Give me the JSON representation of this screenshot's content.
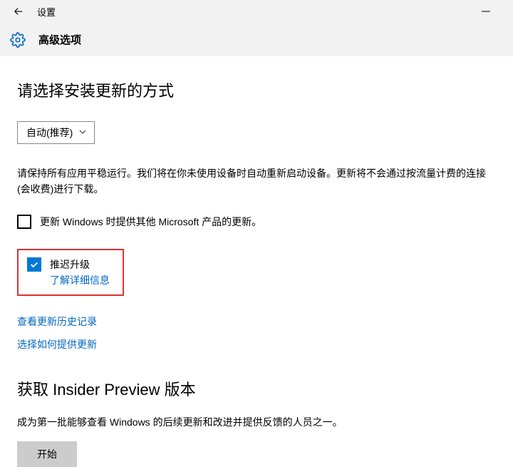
{
  "titlebar": {
    "title": "设置"
  },
  "subheader": {
    "title": "高级选项"
  },
  "section1": {
    "heading": "请选择安装更新的方式",
    "dropdown_value": "自动(推荐)",
    "paragraph": "请保持所有应用平稳运行。我们将在你未使用设备时自动重新启动设备。更新将不会通过按流量计费的连接(会收费)进行下载。",
    "checkbox_other_label": "更新 Windows 时提供其他 Microsoft 产品的更新。"
  },
  "defer": {
    "label": "推迟升级",
    "learn_more": "了解详细信息"
  },
  "links": {
    "history": "查看更新历史记录",
    "delivery": "选择如何提供更新"
  },
  "insider": {
    "heading": "获取 Insider Preview 版本",
    "desc": "成为第一批能够查看 Windows 的后续更新和改进并提供反馈的人员之一。",
    "start": "开始"
  }
}
